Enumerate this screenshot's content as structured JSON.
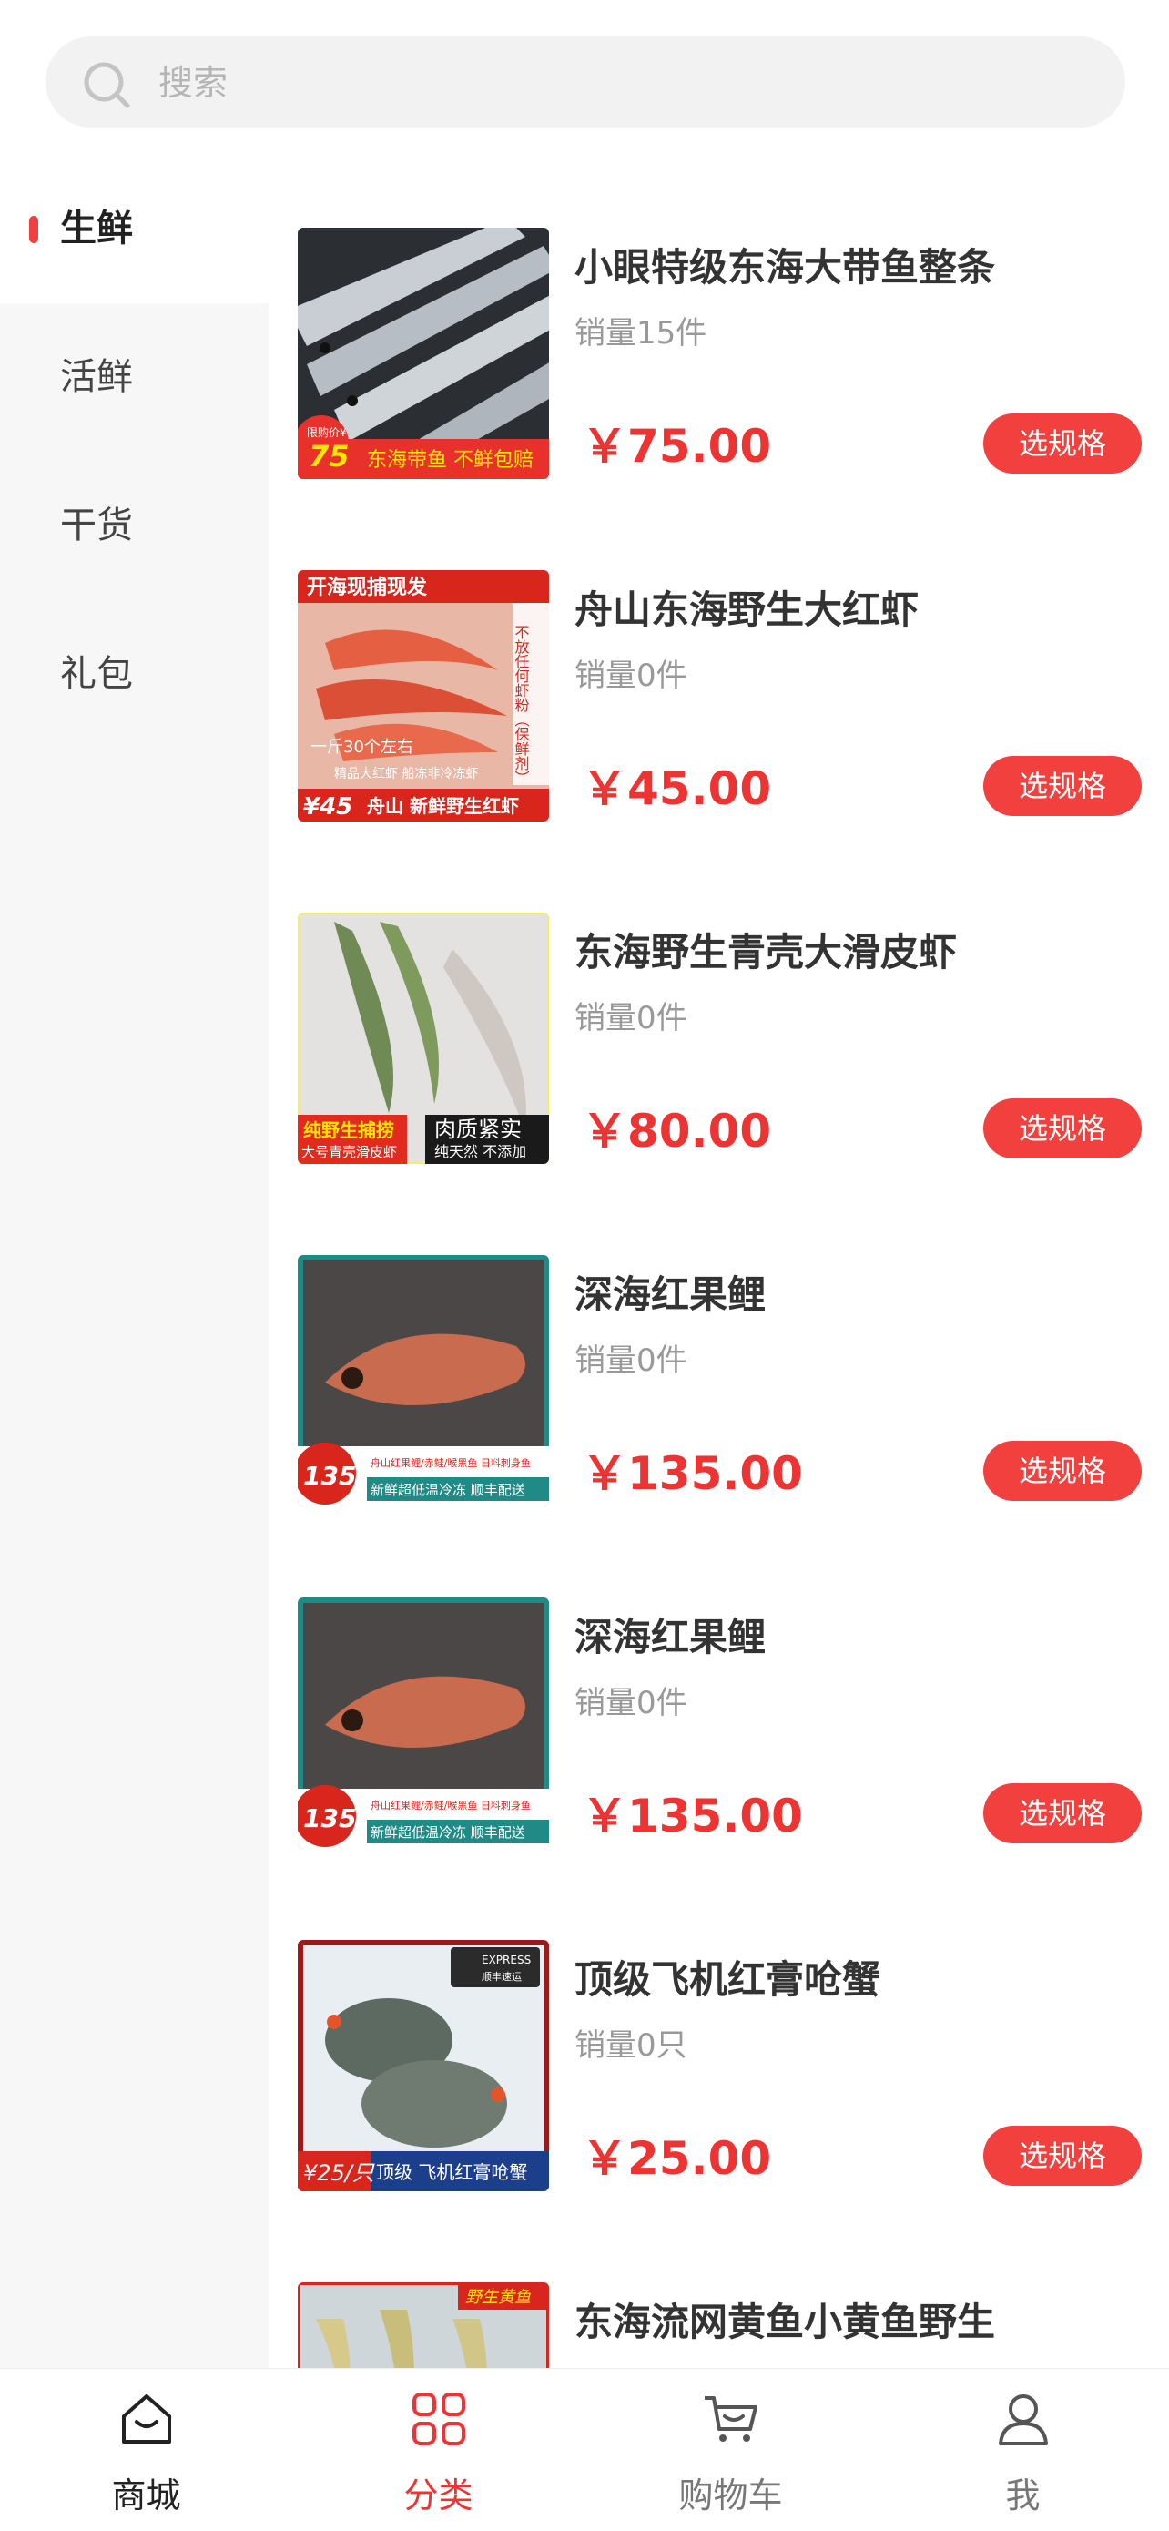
{
  "search": {
    "placeholder": "搜索"
  },
  "sidebar": {
    "items": [
      {
        "label": "生鲜",
        "active": true
      },
      {
        "label": "活鲜",
        "active": false
      },
      {
        "label": "干货",
        "active": false
      },
      {
        "label": "礼包",
        "active": false
      }
    ]
  },
  "products": [
    {
      "name": "小眼特级东海大带鱼整条",
      "sales": "销量15件",
      "price": "￥75.00",
      "button": "选规格",
      "image_text": [
        "限购价¥",
        "75",
        "东海带鱼 不鲜包赔"
      ]
    },
    {
      "name": "舟山东海野生大红虾",
      "sales": "销量0件",
      "price": "￥45.00",
      "button": "选规格",
      "image_text": [
        "开海现捕现发",
        "不放任何虾粉（保鲜剂）",
        "一斤30个左右",
        "精品大红虾 船冻非冷冻虾",
        "¥45",
        "舟山 新鲜野生红虾"
      ]
    },
    {
      "name": "东海野生青壳大滑皮虾",
      "sales": "销量0件",
      "price": "￥80.00",
      "button": "选规格",
      "image_text": [
        "纯野生捕捞",
        "大号青壳滑皮虾",
        "肉质紧实",
        "纯天然 不添加"
      ]
    },
    {
      "name": "深海红果鲤",
      "sales": "销量0件",
      "price": "￥135.00",
      "button": "选规格",
      "image_text": [
        "135",
        "舟山红果鲤/赤鲑/喉黑鱼 日料刺身鱼",
        "新鲜超低温冷冻 顺丰配送"
      ]
    },
    {
      "name": "深海红果鲤",
      "sales": "销量0件",
      "price": "￥135.00",
      "button": "选规格",
      "image_text": [
        "135",
        "舟山红果鲤/赤鲑/喉黑鱼 日料刺身鱼",
        "新鲜超低温冷冻 顺丰配送"
      ]
    },
    {
      "name": "顶级飞机红膏呛蟹",
      "sales": "销量0只",
      "price": "￥25.00",
      "button": "选规格",
      "image_text": [
        "EXPRESS",
        "顺丰速运",
        "¥25/只",
        "顶级 飞机红膏呛蟹"
      ]
    },
    {
      "name": "东海流网黄鱼小黄鱼野生",
      "sales": "",
      "price": "",
      "button": "",
      "image_text": [
        "野生黄鱼"
      ]
    }
  ],
  "tabbar": {
    "items": [
      {
        "label": "商城",
        "icon": "home-icon"
      },
      {
        "label": "分类",
        "icon": "grid-icon",
        "active": true
      },
      {
        "label": "购物车",
        "icon": "cart-icon"
      },
      {
        "label": "我",
        "icon": "user-icon"
      }
    ]
  },
  "colors": {
    "accent": "#ee3333",
    "button": "#f2403f",
    "sidebar_bg": "#f7f7f7"
  }
}
